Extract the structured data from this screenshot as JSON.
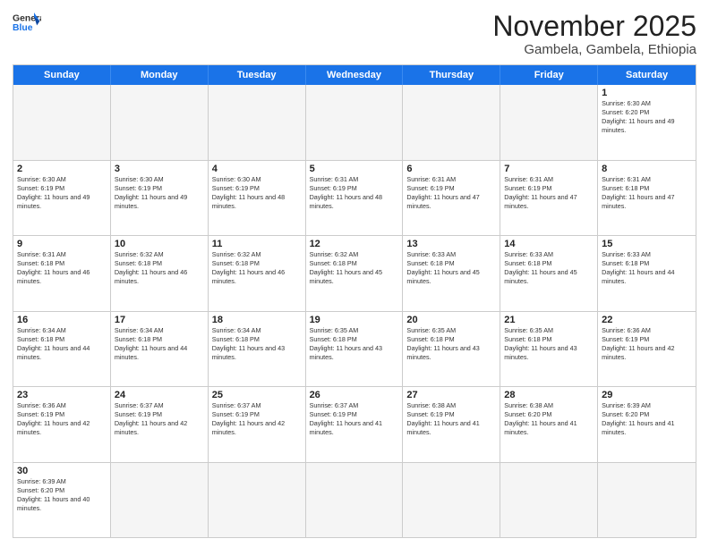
{
  "header": {
    "logo_general": "General",
    "logo_blue": "Blue",
    "month_title": "November 2025",
    "location": "Gambela, Gambela, Ethiopia"
  },
  "weekdays": [
    "Sunday",
    "Monday",
    "Tuesday",
    "Wednesday",
    "Thursday",
    "Friday",
    "Saturday"
  ],
  "rows": [
    [
      {
        "day": "",
        "empty": true
      },
      {
        "day": "",
        "empty": true
      },
      {
        "day": "",
        "empty": true
      },
      {
        "day": "",
        "empty": true
      },
      {
        "day": "",
        "empty": true
      },
      {
        "day": "",
        "empty": true
      },
      {
        "day": "1",
        "sunrise": "6:30 AM",
        "sunset": "6:20 PM",
        "daylight": "11 hours and 49 minutes."
      }
    ],
    [
      {
        "day": "2",
        "sunrise": "6:30 AM",
        "sunset": "6:19 PM",
        "daylight": "11 hours and 49 minutes."
      },
      {
        "day": "3",
        "sunrise": "6:30 AM",
        "sunset": "6:19 PM",
        "daylight": "11 hours and 49 minutes."
      },
      {
        "day": "4",
        "sunrise": "6:30 AM",
        "sunset": "6:19 PM",
        "daylight": "11 hours and 48 minutes."
      },
      {
        "day": "5",
        "sunrise": "6:31 AM",
        "sunset": "6:19 PM",
        "daylight": "11 hours and 48 minutes."
      },
      {
        "day": "6",
        "sunrise": "6:31 AM",
        "sunset": "6:19 PM",
        "daylight": "11 hours and 47 minutes."
      },
      {
        "day": "7",
        "sunrise": "6:31 AM",
        "sunset": "6:19 PM",
        "daylight": "11 hours and 47 minutes."
      },
      {
        "day": "8",
        "sunrise": "6:31 AM",
        "sunset": "6:18 PM",
        "daylight": "11 hours and 47 minutes."
      }
    ],
    [
      {
        "day": "9",
        "sunrise": "6:31 AM",
        "sunset": "6:18 PM",
        "daylight": "11 hours and 46 minutes."
      },
      {
        "day": "10",
        "sunrise": "6:32 AM",
        "sunset": "6:18 PM",
        "daylight": "11 hours and 46 minutes."
      },
      {
        "day": "11",
        "sunrise": "6:32 AM",
        "sunset": "6:18 PM",
        "daylight": "11 hours and 46 minutes."
      },
      {
        "day": "12",
        "sunrise": "6:32 AM",
        "sunset": "6:18 PM",
        "daylight": "11 hours and 45 minutes."
      },
      {
        "day": "13",
        "sunrise": "6:33 AM",
        "sunset": "6:18 PM",
        "daylight": "11 hours and 45 minutes."
      },
      {
        "day": "14",
        "sunrise": "6:33 AM",
        "sunset": "6:18 PM",
        "daylight": "11 hours and 45 minutes."
      },
      {
        "day": "15",
        "sunrise": "6:33 AM",
        "sunset": "6:18 PM",
        "daylight": "11 hours and 44 minutes."
      }
    ],
    [
      {
        "day": "16",
        "sunrise": "6:34 AM",
        "sunset": "6:18 PM",
        "daylight": "11 hours and 44 minutes."
      },
      {
        "day": "17",
        "sunrise": "6:34 AM",
        "sunset": "6:18 PM",
        "daylight": "11 hours and 44 minutes."
      },
      {
        "day": "18",
        "sunrise": "6:34 AM",
        "sunset": "6:18 PM",
        "daylight": "11 hours and 43 minutes."
      },
      {
        "day": "19",
        "sunrise": "6:35 AM",
        "sunset": "6:18 PM",
        "daylight": "11 hours and 43 minutes."
      },
      {
        "day": "20",
        "sunrise": "6:35 AM",
        "sunset": "6:18 PM",
        "daylight": "11 hours and 43 minutes."
      },
      {
        "day": "21",
        "sunrise": "6:35 AM",
        "sunset": "6:18 PM",
        "daylight": "11 hours and 43 minutes."
      },
      {
        "day": "22",
        "sunrise": "6:36 AM",
        "sunset": "6:19 PM",
        "daylight": "11 hours and 42 minutes."
      }
    ],
    [
      {
        "day": "23",
        "sunrise": "6:36 AM",
        "sunset": "6:19 PM",
        "daylight": "11 hours and 42 minutes."
      },
      {
        "day": "24",
        "sunrise": "6:37 AM",
        "sunset": "6:19 PM",
        "daylight": "11 hours and 42 minutes."
      },
      {
        "day": "25",
        "sunrise": "6:37 AM",
        "sunset": "6:19 PM",
        "daylight": "11 hours and 42 minutes."
      },
      {
        "day": "26",
        "sunrise": "6:37 AM",
        "sunset": "6:19 PM",
        "daylight": "11 hours and 41 minutes."
      },
      {
        "day": "27",
        "sunrise": "6:38 AM",
        "sunset": "6:19 PM",
        "daylight": "11 hours and 41 minutes."
      },
      {
        "day": "28",
        "sunrise": "6:38 AM",
        "sunset": "6:20 PM",
        "daylight": "11 hours and 41 minutes."
      },
      {
        "day": "29",
        "sunrise": "6:39 AM",
        "sunset": "6:20 PM",
        "daylight": "11 hours and 41 minutes."
      }
    ],
    [
      {
        "day": "30",
        "sunrise": "6:39 AM",
        "sunset": "6:20 PM",
        "daylight": "11 hours and 40 minutes."
      },
      {
        "day": "",
        "empty": true
      },
      {
        "day": "",
        "empty": true
      },
      {
        "day": "",
        "empty": true
      },
      {
        "day": "",
        "empty": true
      },
      {
        "day": "",
        "empty": true
      },
      {
        "day": "",
        "empty": true
      }
    ]
  ],
  "labels": {
    "sunrise": "Sunrise:",
    "sunset": "Sunset:",
    "daylight": "Daylight:"
  }
}
